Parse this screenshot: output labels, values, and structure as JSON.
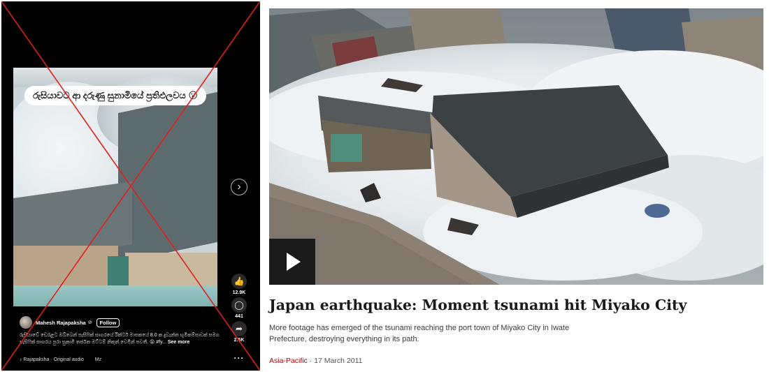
{
  "reel": {
    "overlay_caption": "රුසියාවට ආ දරුණු සුනාමියේ ප්‍රතිඵලවය 😮",
    "author": {
      "name": "Mahesh Rajapaksha",
      "verified_glyph": "⊘",
      "follow_label": "Follow"
    },
    "post_text": "රුසියාවේ චෙරළට ඔබ්බෙන් පැසිෆික් සාගරයේ රික්ටර් මාපකයේ 8.0 ක දුවැන්ත භූමිකම්පාවක් සමග පැසිෆික් සාගරය පුරා සුනාමි තර්ජන මට්ටම් නිකුත් වෙමින් පවතී. 😮 #fy...",
    "see_more_label": "See more",
    "audio": "Rajapaksha · Original audio",
    "audio_extra": "Mz",
    "actions": {
      "like_count": "12.9K",
      "comment_count": "441",
      "share_count": "2.5K"
    },
    "next_glyph": "›",
    "more_glyph": "···"
  },
  "article": {
    "headline": "Japan earthquake: Moment tsunami hit Miyako City",
    "summary": "More footage has emerged of the tsunami reaching the port town of Miyako City in Iwate Prefecture, destroying everything in its path.",
    "section": "Asia-Pacific",
    "separator": "·",
    "date": "17 March 2011"
  },
  "colors": {
    "cross_line": "#e01e1e",
    "section_link": "#b80000",
    "reel_background": "#000000"
  }
}
